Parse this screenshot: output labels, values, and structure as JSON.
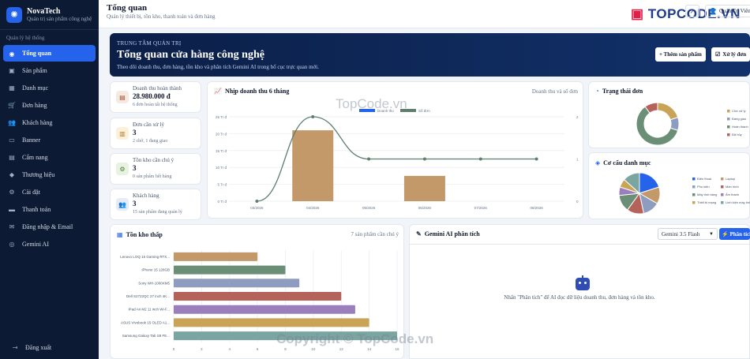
{
  "brand": {
    "name": "NovaTech",
    "subtitle": "Quản trị sản phẩm công nghệ"
  },
  "sidebar": {
    "section_label": "Quản lý hệ thống",
    "items": [
      {
        "label": "Tổng quan",
        "icon": "dashboard-icon",
        "active": true
      },
      {
        "label": "Sản phẩm",
        "icon": "box-icon"
      },
      {
        "label": "Danh mục",
        "icon": "grid-icon"
      },
      {
        "label": "Đơn hàng",
        "icon": "cart-icon"
      },
      {
        "label": "Khách hàng",
        "icon": "users-icon"
      },
      {
        "label": "Banner",
        "icon": "image-icon"
      },
      {
        "label": "Cẩm nang",
        "icon": "book-icon"
      },
      {
        "label": "Thương hiệu",
        "icon": "tag-icon"
      },
      {
        "label": "Cài đặt",
        "icon": "gear-icon"
      },
      {
        "label": "Thanh toán",
        "icon": "card-icon"
      },
      {
        "label": "Đăng nhập & Email",
        "icon": "mail-icon"
      },
      {
        "label": "Gemini AI",
        "icon": "robot-icon"
      }
    ],
    "logout_label": "Đăng xuất"
  },
  "header": {
    "title": "Tổng quan",
    "subtitle": "Quản lý thiết bị, tồn kho, thanh toán và đơn hàng",
    "user_name": "Quản Trị Viên",
    "watermark_logo": "TOPCODE.VN"
  },
  "hero": {
    "eyebrow": "TRUNG TÂM QUẢN TRỊ",
    "title": "Tổng quan cửa hàng công nghệ",
    "description": "Theo dõi doanh thu, đơn hàng, tồn kho và phân tích Gemini AI trong bố cục trực quan mới.",
    "add_product_label": "+ Thêm sản phẩm",
    "process_orders_label": "Xử lý đơn"
  },
  "stats": [
    {
      "label": "Doanh thu hoàn thành",
      "value": "28.980.000 đ",
      "note": "6 đơn hoàn tất hệ thống",
      "color": "#a0522d",
      "bg": "#f6e9e1",
      "icon": "money-icon"
    },
    {
      "label": "Đơn cần xử lý",
      "value": "3",
      "note": "2 chờ, 1 đang giao",
      "color": "#b7791f",
      "bg": "#fbf1db",
      "icon": "clipboard-icon"
    },
    {
      "label": "Tồn kho cần chú ý",
      "value": "3",
      "note": "0 sản phẩm hết hàng",
      "color": "#4d7c3a",
      "bg": "#e7f2e1",
      "icon": "warehouse-icon"
    },
    {
      "label": "Khách hàng",
      "value": "3",
      "note": "15 sản phẩm đang quản lý",
      "color": "#4b5e8a",
      "bg": "#e6ebf5",
      "icon": "users-icon"
    }
  ],
  "revenue": {
    "title": "Nhịp doanh thu 6 tháng",
    "meta": "Doanh thu và số đơn"
  },
  "order_status": {
    "title": "Trạng thái đơn"
  },
  "category_mix": {
    "title": "Cơ cấu danh mục"
  },
  "low_stock": {
    "title": "Tồn kho thấp",
    "meta": "7 sản phẩm cần chú ý"
  },
  "ai": {
    "title": "Gemini AI phân tích",
    "model": "Gemini 3.5 Flash",
    "analyze_label": "⚡ Phân tích",
    "hint": "Nhấn \"Phân tích\" để AI đọc dữ liệu doanh thu, đơn hàng và tồn kho."
  },
  "watermarks": {
    "copyright": "Copyright © TopCode.vn",
    "mid": "TopCode.vn"
  },
  "chart_data": [
    {
      "type": "bar",
      "categories": [
        "03/2026",
        "04/2026",
        "05/2026",
        "06/2026",
        "07/2026",
        "08/2026"
      ],
      "series": [
        {
          "name": "Doanh thu",
          "axis": "left",
          "kind": "bar",
          "values": [
            0,
            21000000,
            0,
            7500000,
            0,
            0
          ],
          "color": "#c4996a"
        },
        {
          "name": "Số đơn",
          "axis": "right",
          "kind": "line",
          "values": [
            0,
            2,
            1,
            1,
            1,
            1
          ],
          "color": "#5f7f6e"
        }
      ],
      "yticks_left": [
        "0 Tr đ",
        "5 Tr đ",
        "10 Tr đ",
        "15 Tr đ",
        "20 Tr đ",
        "25 Tr đ"
      ],
      "ylim_left": [
        0,
        25000000
      ],
      "yticks_right": [
        "0",
        "1",
        "2"
      ],
      "ylim_right": [
        0,
        2
      ]
    },
    {
      "type": "pie",
      "donut": true,
      "labels": [
        "Chờ xử lý",
        "Đang giao",
        "Hoàn thành",
        "Đã hủy"
      ],
      "values": [
        2,
        1,
        6,
        1
      ],
      "colors": [
        "#c9a457",
        "#8e9dbf",
        "#6b8f76",
        "#b5635a"
      ],
      "legend": "right"
    },
    {
      "type": "pie",
      "labels": [
        "Điện thoại",
        "Laptop",
        "Phụ kiện",
        "Màn hình",
        "Máy tính bảng",
        "Âm thanh",
        "Thiết bị mạng",
        "Linh kiện máy tính"
      ],
      "values": [
        3,
        2,
        2,
        2,
        2,
        1,
        1,
        2
      ],
      "colors": [
        "#2563eb",
        "#c4996a",
        "#8e9dbf",
        "#b5635a",
        "#6b8f76",
        "#9b7fbd",
        "#c9a457",
        "#7aa5a0"
      ],
      "legend": "right"
    },
    {
      "type": "bar",
      "orientation": "horizontal",
      "categories": [
        "Lenovo LOQ 15 Gaming RTX...",
        "iPhone 15 128GB",
        "Sony WH-1000XM5",
        "Dell S2722QC 27 inch 4K...",
        "iPad Air M2 11 inch Wi-F...",
        "ASUS Vivobook 15 OLED A1...",
        "Samsung Galaxy Tab S9 FE..."
      ],
      "values": [
        6,
        8,
        9,
        12,
        13,
        14,
        16
      ],
      "colors": [
        "#c4996a",
        "#6b8f76",
        "#8e9dbf",
        "#b5635a",
        "#9b7fbd",
        "#c9a457",
        "#7aa5a0"
      ],
      "xticks": [
        "0",
        "2",
        "4",
        "6",
        "8",
        "10",
        "12",
        "14",
        "16"
      ],
      "xlim": [
        0,
        16
      ]
    }
  ]
}
